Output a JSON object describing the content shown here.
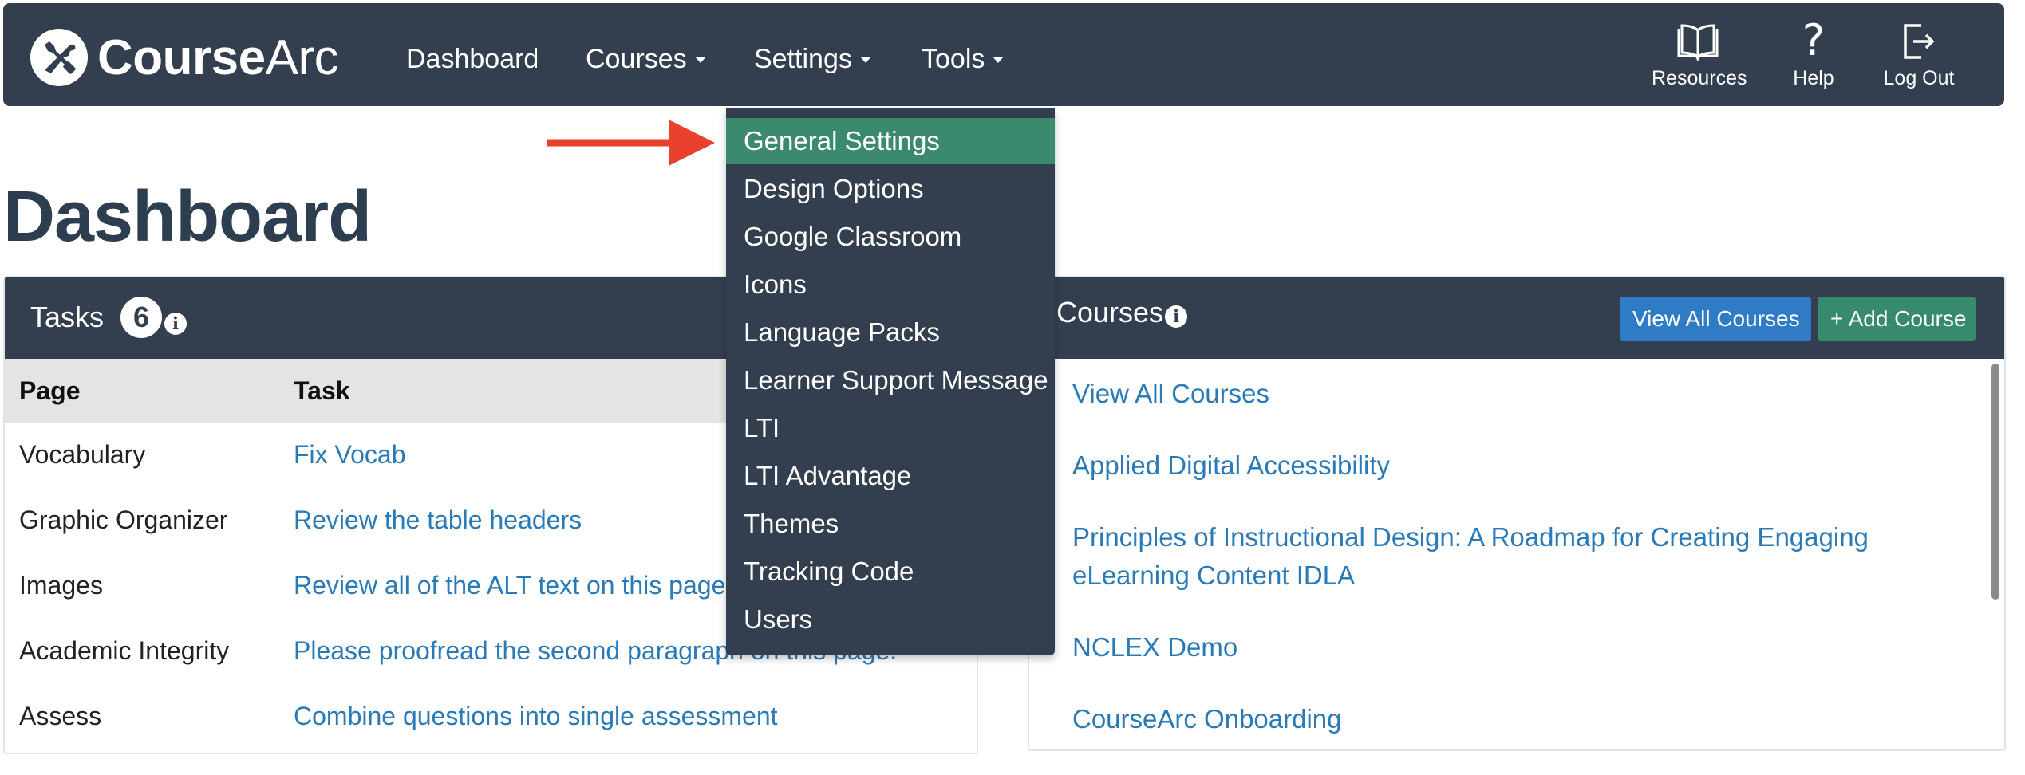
{
  "navbar": {
    "logo": {
      "bold": "Course",
      "light": "Arc"
    },
    "menu": [
      {
        "label": "Dashboard",
        "has_caret": false
      },
      {
        "label": "Courses",
        "has_caret": true
      },
      {
        "label": "Settings",
        "has_caret": true
      },
      {
        "label": "Tools",
        "has_caret": true
      }
    ],
    "utilities": [
      {
        "label": "Resources",
        "icon": "book-icon"
      },
      {
        "label": "Help",
        "icon": "question-icon"
      },
      {
        "label": "Log Out",
        "icon": "logout-icon"
      }
    ]
  },
  "settings_menu": {
    "items": [
      "General Settings",
      "Design Options",
      "Google Classroom",
      "Icons",
      "Language Packs",
      "Learner Support Message",
      "LTI",
      "LTI Advantage",
      "Themes",
      "Tracking Code",
      "Users"
    ],
    "active_index": 0
  },
  "page": {
    "title": "Dashboard"
  },
  "tasks": {
    "title": "Tasks",
    "count": "6",
    "info": "i",
    "columns": {
      "page": "Page",
      "task": "Task"
    },
    "rows": [
      {
        "page": "Vocabulary",
        "task": "Fix Vocab"
      },
      {
        "page": "Graphic Organizer",
        "task": "Review the table headers"
      },
      {
        "page": "Images",
        "task": "Review all of the ALT text on this page"
      },
      {
        "page": "Academic Integrity",
        "task": "Please proofread the second paragraph on this page."
      },
      {
        "page": "Assess",
        "task": "Combine questions into single assessment"
      }
    ]
  },
  "courses": {
    "title": "Courses",
    "info": "i",
    "view_all_button": "View All Courses",
    "add_button": "+ Add Course",
    "links": [
      "View All Courses",
      "Applied Digital Accessibility",
      "Principles of Instructional Design: A Roadmap for Creating Engaging eLearning Content IDLA",
      "NCLEX Demo",
      "CourseArc Onboarding"
    ]
  },
  "colors": {
    "navbar": "#333e4f",
    "active_menu": "#3b8a6e",
    "link": "#2a7ab8",
    "primary_button": "#2f7bc6",
    "success_button": "#388a6d",
    "annotation_arrow": "#e8412c"
  }
}
